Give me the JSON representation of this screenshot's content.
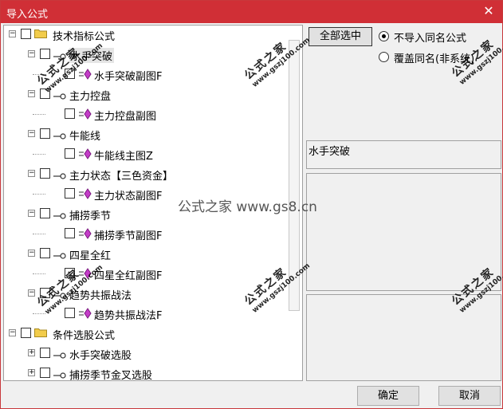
{
  "window": {
    "title": "导入公式",
    "close_glyph": "✕"
  },
  "tree": {
    "groups": [
      {
        "label": "技术指标公式",
        "expander": "−",
        "items": [
          {
            "label": "水手突破",
            "selected": true,
            "child": "水手突破副图F"
          },
          {
            "label": "主力控盘",
            "child": "主力控盘副图"
          },
          {
            "label": "牛能线",
            "child": "牛能线主图Z"
          },
          {
            "label": "主力状态【三色资金】",
            "child": "主力状态副图F"
          },
          {
            "label": "捕捞季节",
            "child": "捕捞季节副图F"
          },
          {
            "label": "四星全红",
            "child": "四星全红副图F"
          },
          {
            "label": "趋势共振战法",
            "child": "趋势共振战法F"
          }
        ]
      },
      {
        "label": "条件选股公式",
        "expander": "−",
        "items": [
          {
            "label": "水手突破选股"
          },
          {
            "label": "捕捞季节金叉选股"
          }
        ]
      }
    ]
  },
  "right": {
    "select_all_label": "全部选中",
    "radio_options": [
      {
        "label": "不导入同名公式",
        "checked": true
      },
      {
        "label": "覆盖同名(非系统)",
        "checked": false
      }
    ],
    "formula_name": "水手突破"
  },
  "footer": {
    "ok_label": "确定",
    "cancel_label": "取消"
  },
  "watermark": {
    "center_text": "公式之家 www.gs8.cn",
    "stamp_cn": "公式之家",
    "stamp_url": "www.gszj100.com"
  },
  "colors": {
    "titlebar": "#d02f36",
    "gem": "#c43cc8",
    "folder": "#f2cc4b"
  },
  "icons": {
    "folder": "folder-icon",
    "key": "key-icon",
    "gem": "formula-gem-icon"
  }
}
